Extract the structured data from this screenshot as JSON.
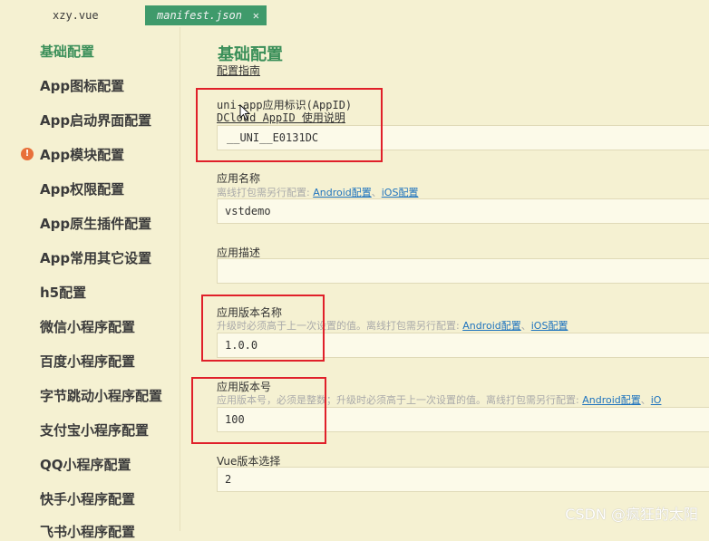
{
  "tabs": [
    {
      "label": "xzy.vue"
    },
    {
      "label": "manifest.json",
      "close": "✕"
    }
  ],
  "sidebar": {
    "items": [
      {
        "label": "基础配置",
        "active": true
      },
      {
        "label": "App图标配置"
      },
      {
        "label": "App启动界面配置"
      },
      {
        "label": "App模块配置",
        "warning": true
      },
      {
        "label": "App权限配置"
      },
      {
        "label": "App原生插件配置"
      },
      {
        "label": "App常用其它设置"
      },
      {
        "label": "h5配置"
      },
      {
        "label": "微信小程序配置"
      },
      {
        "label": "百度小程序配置"
      },
      {
        "label": "字节跳动小程序配置"
      },
      {
        "label": "支付宝小程序配置"
      },
      {
        "label": "QQ小程序配置"
      },
      {
        "label": "快手小程序配置"
      },
      {
        "label": "飞书小程序配置"
      }
    ],
    "warning_glyph": "!"
  },
  "main": {
    "title": "基础配置",
    "guide_link": "配置指南",
    "appid": {
      "label": "uni-app应用标识(AppID)",
      "help_link": "DCloud AppID 使用说明",
      "value": "__UNI__E0131DC"
    },
    "app_name": {
      "label": "应用名称",
      "hint": "离线打包需另行配置:",
      "android_link": "Android配置",
      "sep": "、",
      "ios_link": "iOS配置",
      "value": "vstdemo"
    },
    "app_desc": {
      "label": "应用描述",
      "value": ""
    },
    "version_name": {
      "label": "应用版本名称",
      "hint": "升级时必须高于上一次设置的值。离线打包需另行配置:",
      "android_link": "Android配置",
      "sep": "、",
      "ios_link": "iOS配置",
      "value": "1.0.0"
    },
    "version_code": {
      "label": "应用版本号",
      "hint": "应用版本号，必须是整数；升级时必须高于上一次设置的值。离线打包需另行配置:",
      "android_link": "Android配置",
      "sep": "、",
      "ios_link": "iO",
      "value": "100"
    },
    "vue_version": {
      "label": "Vue版本选择",
      "value": "2"
    }
  },
  "watermark": "CSDN @疯狂的太阳"
}
